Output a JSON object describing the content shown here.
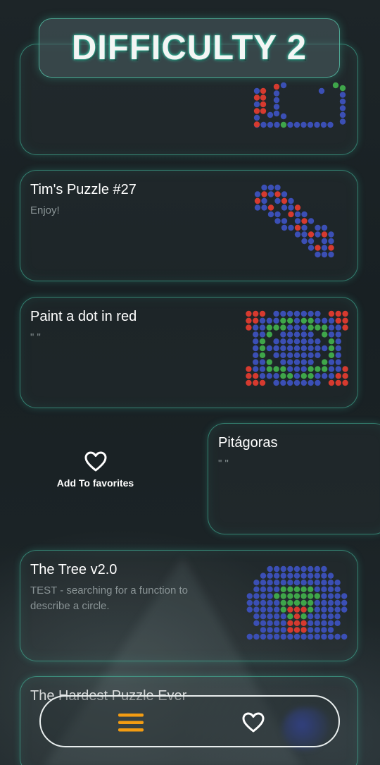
{
  "header": {
    "title": "DIFFICULTY 2"
  },
  "puzzles": [
    {
      "title": "Tim's Puzzle #27",
      "subtitle": "Enjoy!"
    },
    {
      "title": "Paint a dot in red",
      "subtitle": "\" \""
    },
    {
      "title": "Pitágoras",
      "subtitle": "\" \""
    },
    {
      "title": "The Tree v2.0",
      "subtitle": "TEST - searching for a function to describe a circle."
    },
    {
      "title": "The Hardest Puzzle Ever"
    }
  ],
  "swipe_action": {
    "label": "Add To favorites",
    "icon": "heart-outline-icon"
  },
  "bottom_nav": {
    "menu_icon": "hamburger-menu-icon",
    "favorites_icon": "heart-outline-icon"
  },
  "colors": {
    "accent": "#3dd6b0",
    "menu_icon": "#f39c12",
    "dot_blue": "#3b4fb5",
    "dot_red": "#d63a2f",
    "dot_green": "#3fa64a"
  }
}
